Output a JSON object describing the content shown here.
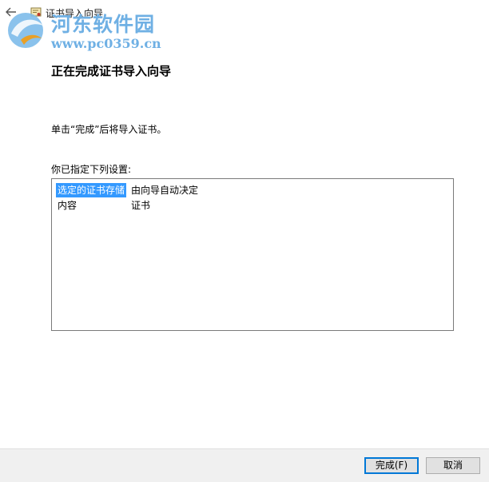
{
  "window": {
    "title": "证书导入向导"
  },
  "watermark": {
    "title": "河东软件园",
    "url": "www.pc0359.cn"
  },
  "heading": "正在完成证书导入向导",
  "instruction": "单击“完成”后将导入证书。",
  "settings": {
    "label": "你已指定下列设置:",
    "rows": [
      {
        "key": "选定的证书存储",
        "value": "由向导自动决定",
        "selected": true
      },
      {
        "key": "内容",
        "value": "证书",
        "selected": false
      }
    ]
  },
  "buttons": {
    "finish": "完成(F)",
    "cancel": "取消"
  },
  "colors": {
    "selection": "#3399ff",
    "primary_border": "#0078d7",
    "watermark": "#6fb0e4",
    "footer_bg": "#f0f0f0"
  },
  "icons": {
    "back": "arrow-left-icon",
    "wizard": "certificate-wizard-icon",
    "watermark_logo": "site-logo-icon"
  }
}
